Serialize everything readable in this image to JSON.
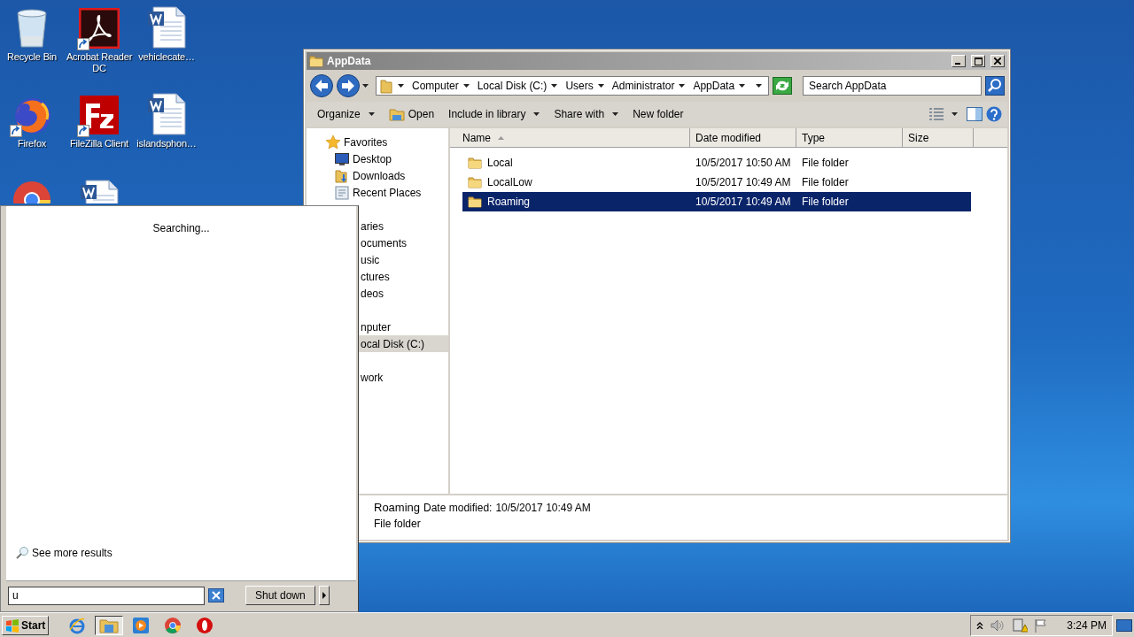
{
  "desktop_icons": [
    {
      "label": "Recycle Bin",
      "kind": "recycle",
      "shortcut": false
    },
    {
      "label": "Acrobat Reader DC",
      "kind": "acrobat",
      "shortcut": true
    },
    {
      "label": "vehiclecate…",
      "kind": "word",
      "shortcut": false
    },
    {
      "label": "Firefox",
      "kind": "firefox",
      "shortcut": true
    },
    {
      "label": "FileZilla Client",
      "kind": "filezilla",
      "shortcut": true
    },
    {
      "label": "islandsphon…",
      "kind": "word",
      "shortcut": false
    },
    {
      "kind": "chrome",
      "shortcut": false
    },
    {
      "kind": "word",
      "shortcut": false
    }
  ],
  "explorer": {
    "title": "AppData",
    "breadcrumb": [
      "Computer",
      "Local Disk (C:)",
      "Users",
      "Administrator",
      "AppData"
    ],
    "search": {
      "placeholder": "Search AppData"
    },
    "toolbar": [
      {
        "label": "Organize",
        "kind": "menu"
      },
      {
        "label": "Open",
        "kind": "open"
      },
      {
        "label": "Include in library",
        "kind": "menu"
      },
      {
        "label": "Share with",
        "kind": "menu"
      },
      {
        "label": "New folder",
        "kind": "plain"
      }
    ],
    "nav": [
      {
        "label": "Favorites",
        "kind": "star",
        "selected": false,
        "children": [
          {
            "label": "Desktop",
            "kind": "desktop",
            "selected": false
          },
          {
            "label": "Downloads",
            "kind": "downloads",
            "selected": false
          },
          {
            "label": "Recent Places",
            "kind": "recent",
            "selected": false
          }
        ]
      },
      {
        "label": "aries",
        "selected": false,
        "children": [
          {
            "label": "ocuments",
            "selected": false
          },
          {
            "label": "usic",
            "selected": false
          },
          {
            "label": "ctures",
            "selected": false
          },
          {
            "label": "deos",
            "selected": false
          }
        ]
      },
      {
        "label": "nputer",
        "selected": false,
        "children": [
          {
            "label": "ocal Disk (C:)",
            "selected": true
          }
        ]
      },
      {
        "label": "work",
        "selected": false
      }
    ],
    "columns": [
      {
        "label": "Name",
        "sorted": true
      },
      {
        "label": "Date modified",
        "sorted": false
      },
      {
        "label": "Type",
        "sorted": false
      },
      {
        "label": "Size",
        "sorted": false
      }
    ],
    "files": [
      {
        "name": "Local",
        "date": "10/5/2017 10:50 AM",
        "type": "File folder",
        "selected": false
      },
      {
        "name": "LocalLow",
        "date": "10/5/2017 10:49 AM",
        "type": "File folder",
        "selected": false
      },
      {
        "name": "Roaming",
        "date": "10/5/2017 10:49 AM",
        "type": "File folder",
        "selected": true
      }
    ],
    "details": {
      "name": "Roaming",
      "date_label": "Date modified:",
      "date": "10/5/2017 10:49 AM",
      "type": "File folder"
    }
  },
  "start_menu": {
    "status": "Searching...",
    "more": "See more results",
    "search": {
      "value": "u"
    },
    "shutdown": "Shut down"
  },
  "taskbar": {
    "start": "Start",
    "apps": [
      {
        "kind": "ie",
        "active": false
      },
      {
        "kind": "explorer",
        "active": true
      },
      {
        "kind": "media",
        "active": false
      },
      {
        "kind": "chrome",
        "active": false
      },
      {
        "kind": "opera",
        "active": false
      }
    ],
    "clock": "3:24 PM"
  }
}
